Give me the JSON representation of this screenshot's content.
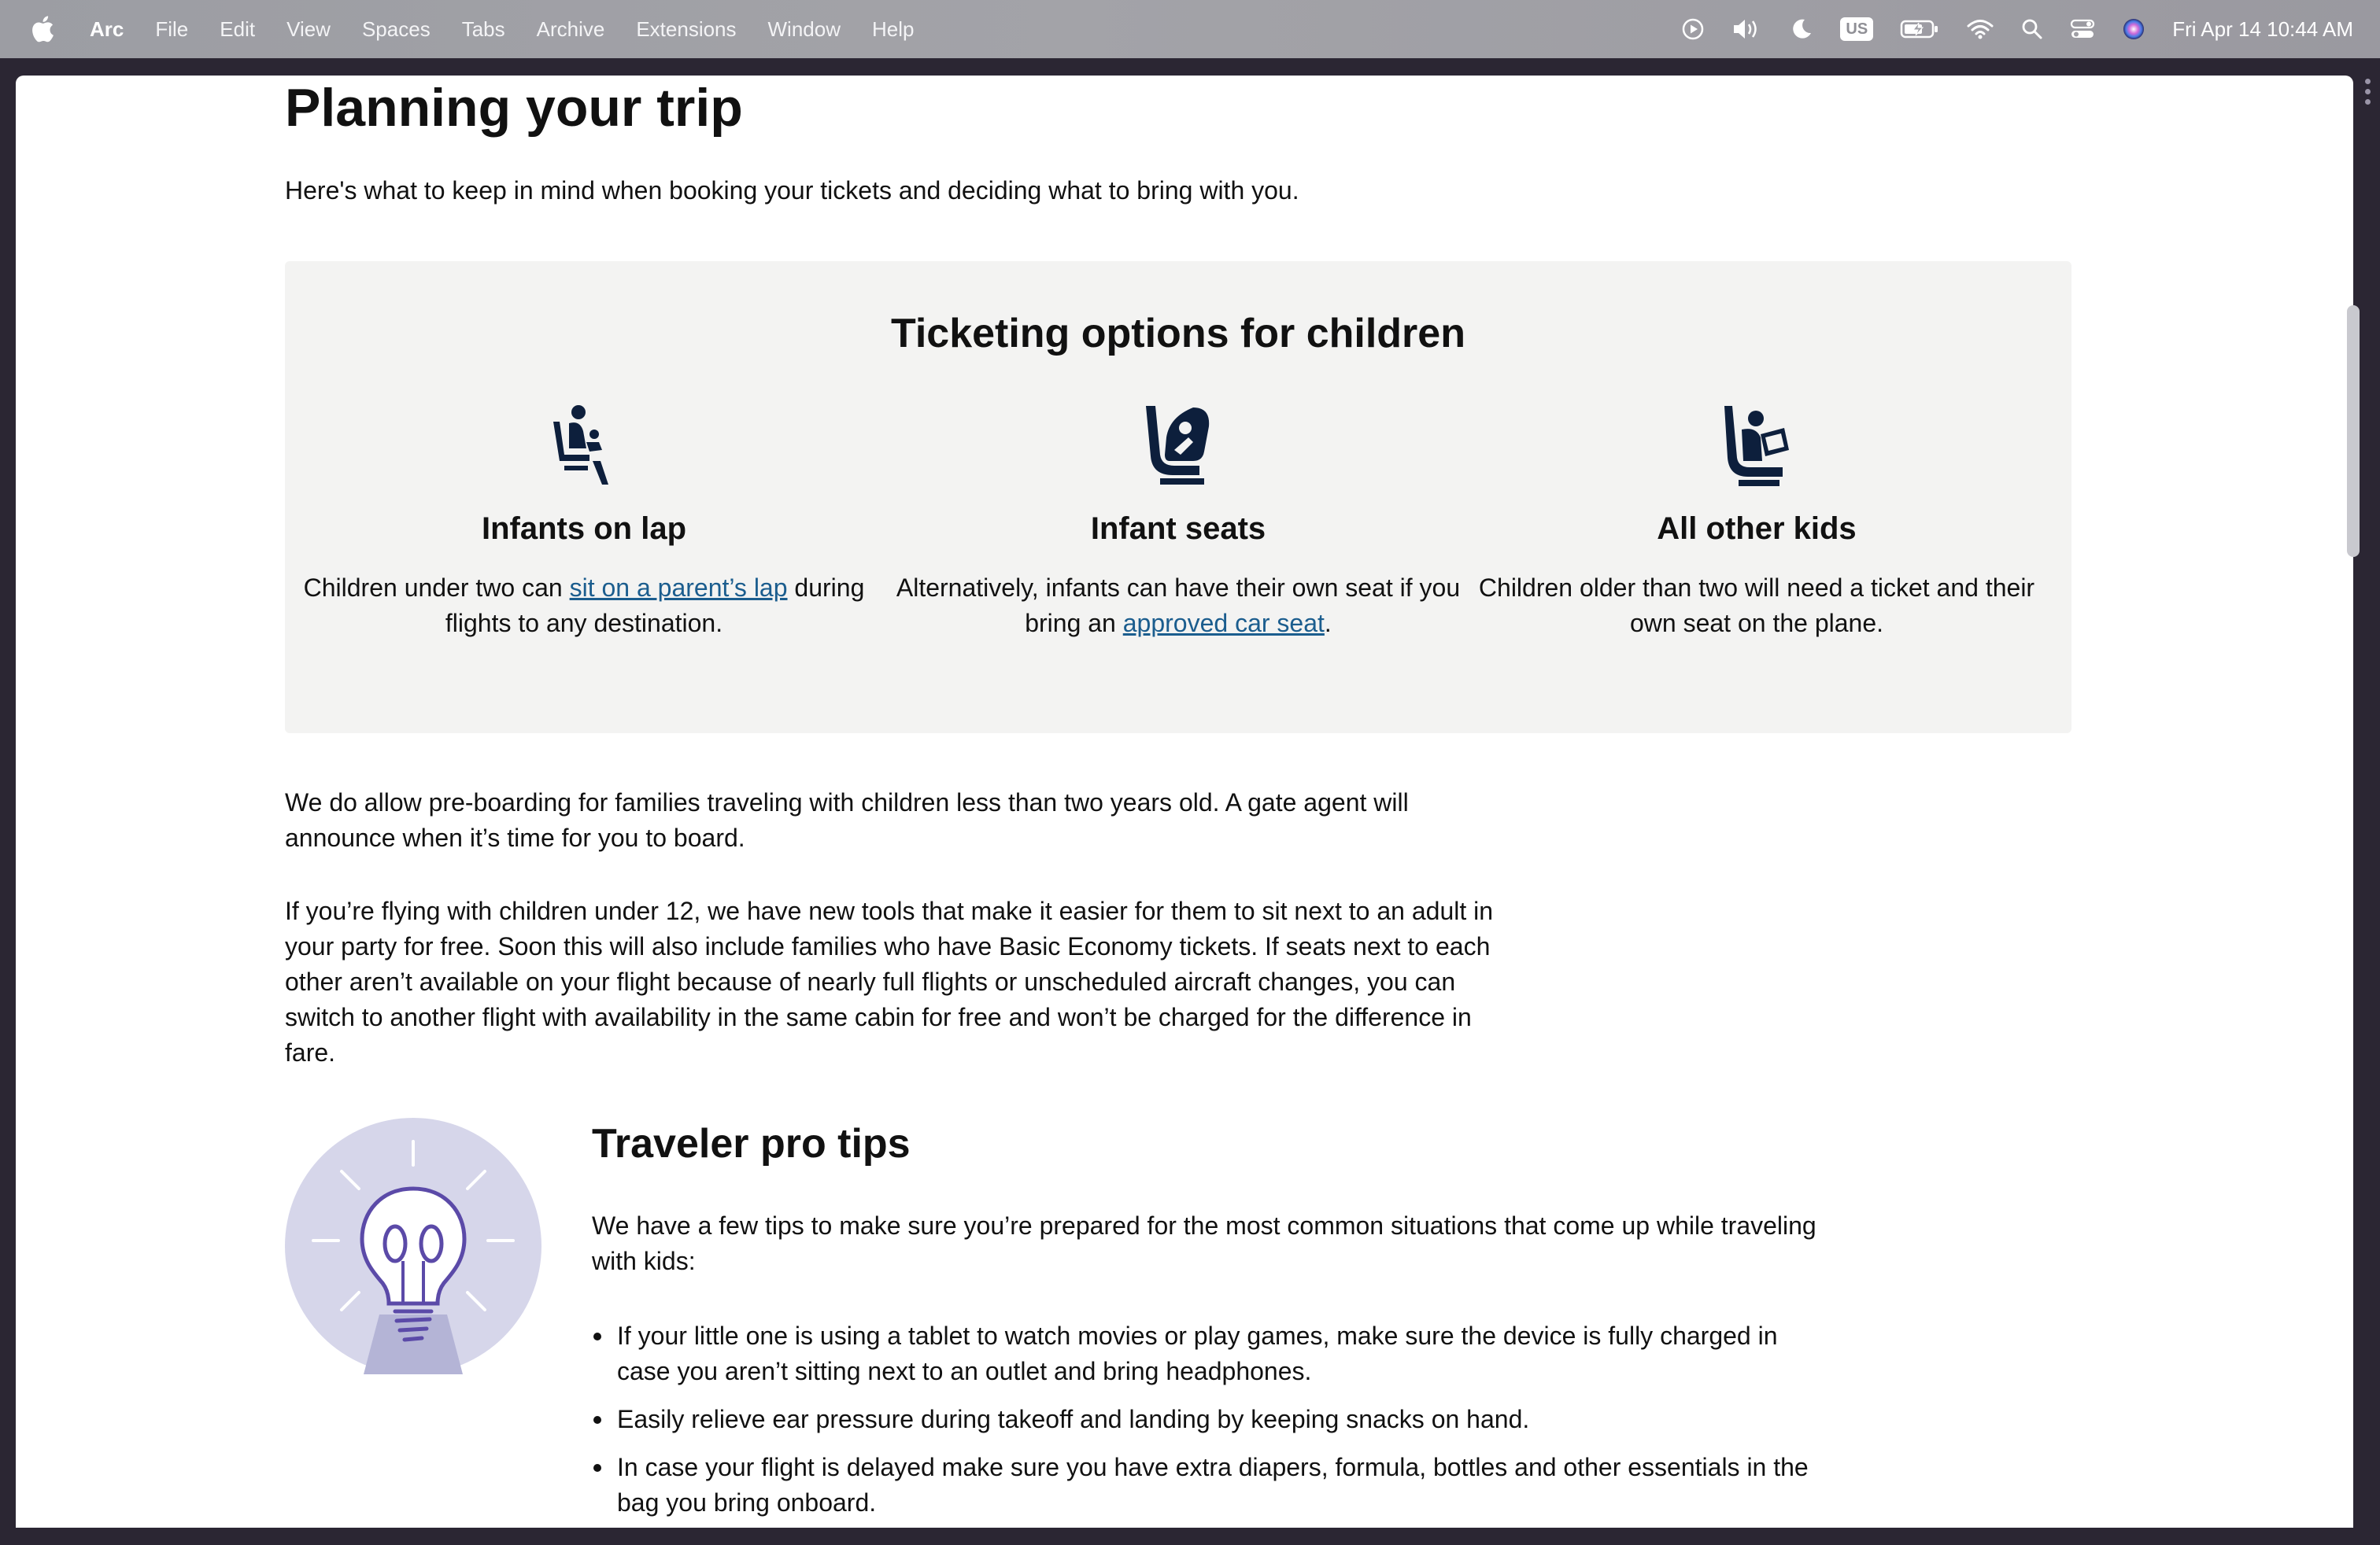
{
  "menubar": {
    "app_name": "Arc",
    "items": [
      "File",
      "Edit",
      "View",
      "Spaces",
      "Tabs",
      "Archive",
      "Extensions",
      "Window",
      "Help"
    ],
    "keyboard_layout": "US",
    "clock": "Fri Apr 14  10:44 AM"
  },
  "page": {
    "title": "Planning your trip",
    "intro": "Here's what to keep in mind when booking your tickets and deciding what to bring with you.",
    "ticketing": {
      "title": "Ticketing options for children",
      "options": [
        {
          "icon": "lap-infant-icon",
          "title": "Infants on lap",
          "desc_before": "Children under two can ",
          "link": "sit on a parent’s lap",
          "desc_after": " during flights to any destination."
        },
        {
          "icon": "car-seat-icon",
          "title": "Infant seats",
          "desc_before": "Alternatively, infants can have their own seat if you bring an ",
          "link": "approved car seat",
          "desc_after": "."
        },
        {
          "icon": "kid-seat-icon",
          "title": "All other kids",
          "desc_before": "Children older than two will need a ticket and their own seat on the plane.",
          "link": "",
          "desc_after": ""
        }
      ]
    },
    "paragraphs": [
      "We do allow pre-boarding for families traveling with children less than two years old. A gate agent will announce when it’s time for you to board.",
      "If you’re flying with children under 12, we have new tools that make it easier for them to sit next to an adult in your party for free. Soon this will also include families who have Basic Economy tickets. If seats next to each other aren’t available on your flight because of nearly full flights or unscheduled aircraft changes, you can switch to another flight with availability in the same cabin for free and won’t be charged for the difference in fare."
    ],
    "tips": {
      "title": "Traveler pro tips",
      "intro": "We have a few tips to make sure you’re prepared for the most common situations that come up while traveling with kids:",
      "items": [
        "If your little one is using a tablet to watch movies or play games, make sure the device is fully charged in case you aren’t sitting next to an outlet and bring headphones.",
        "Easily relieve ear pressure during takeoff and landing by keeping snacks on hand.",
        "In case your flight is delayed make sure you have extra diapers, formula, bottles and other essentials in the bag you bring onboard."
      ]
    }
  },
  "colors": {
    "link": "#1b5d8e",
    "icon_navy": "#0d1f3c",
    "tips_circle": "#d6d6ea",
    "bulb_purple": "#5b4aa8"
  }
}
